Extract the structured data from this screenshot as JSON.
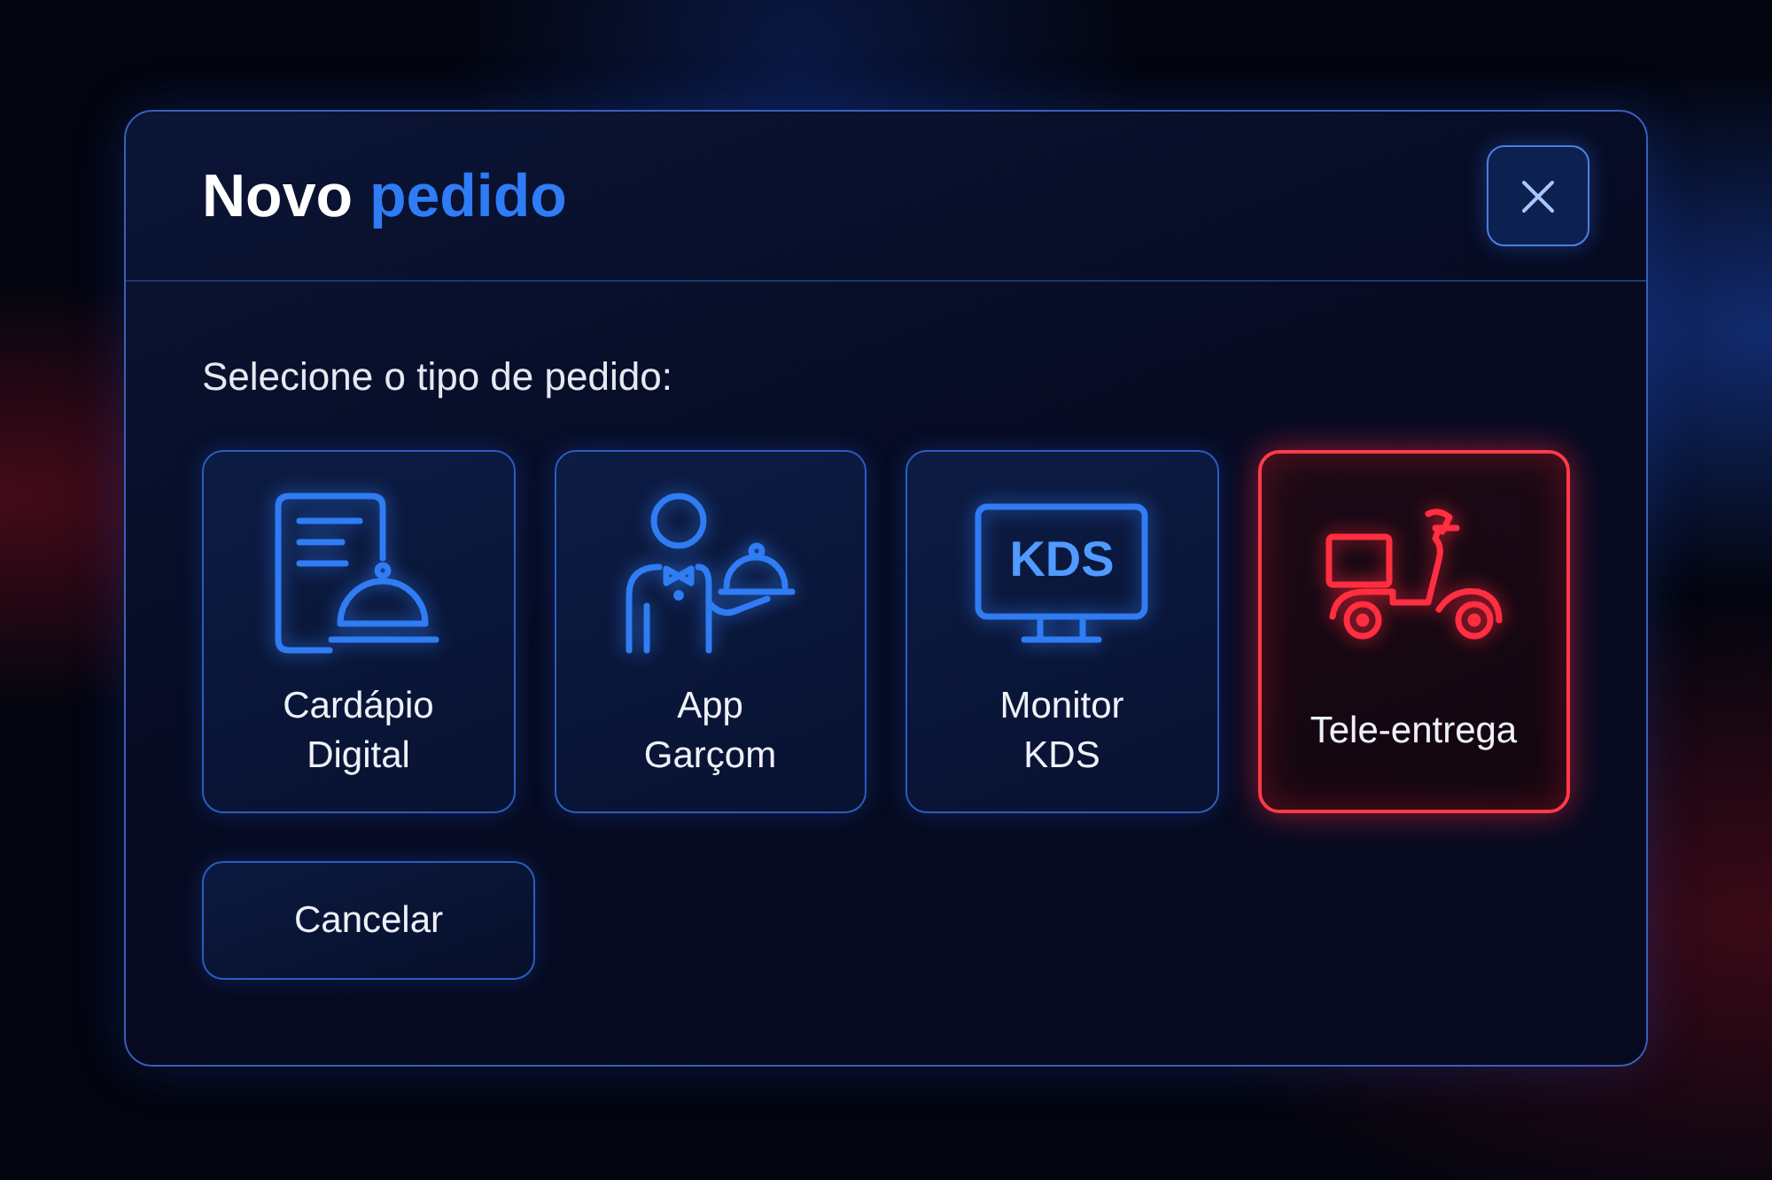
{
  "dialog": {
    "title": {
      "parts": [
        {
          "text": "Novo",
          "highlighted": false
        },
        {
          "text": "pedido",
          "highlighted": true
        }
      ]
    },
    "prompt": "Selecione o tipo de pedido:",
    "order_types": [
      {
        "label": "Cardápio\nDigital",
        "selected": false
      },
      {
        "label": "App\nGarçom",
        "selected": false
      },
      {
        "label": "Monitor\nKDS",
        "selected": false,
        "screen_text": "KDS"
      },
      {
        "label": "Tele-entrega",
        "selected": true
      }
    ],
    "buttons": [
      "Cancelar"
    ]
  }
}
